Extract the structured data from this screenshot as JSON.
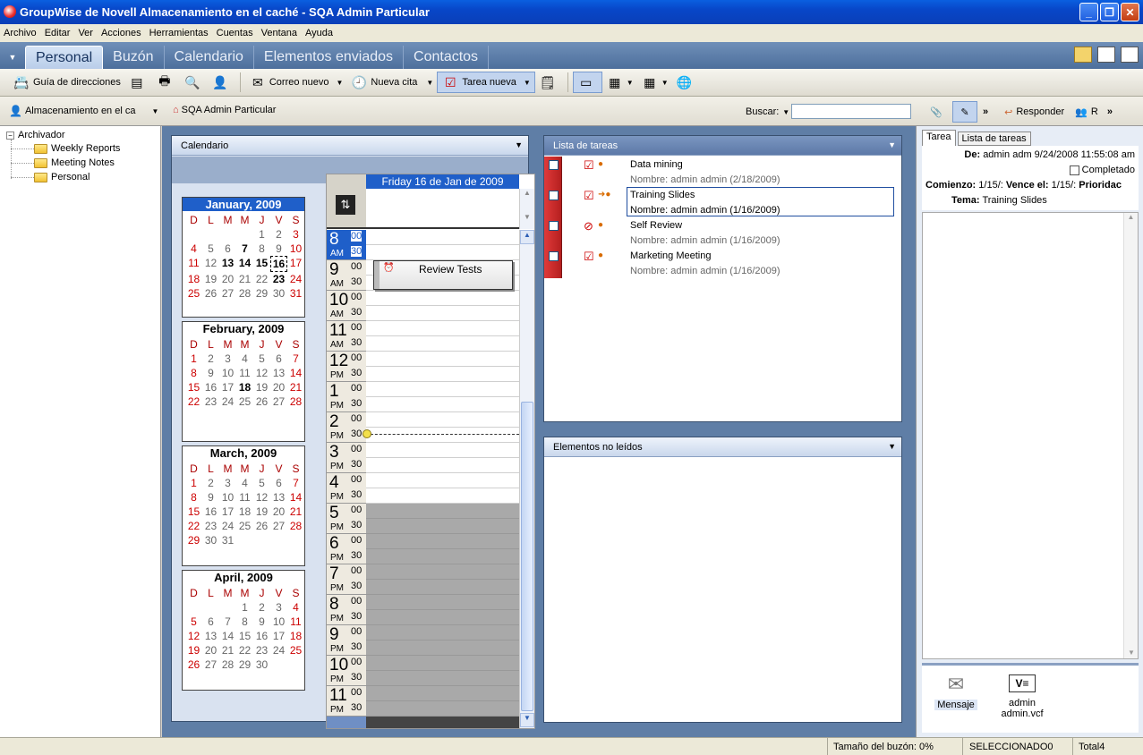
{
  "window": {
    "title": "GroupWise de Novell Almacenamiento en el caché - SQA Admin Particular",
    "min": "_",
    "max": "❐",
    "close": "✕"
  },
  "menu": [
    "Archivo",
    "Editar",
    "Ver",
    "Acciones",
    "Herramientas",
    "Cuentas",
    "Ventana",
    "Ayuda"
  ],
  "nav_tabs": [
    "Personal",
    "Buzón",
    "Calendario",
    "Elementos enviados",
    "Contactos"
  ],
  "toolbar": {
    "address_book": "Guía de direcciones",
    "new_mail": "Correo nuevo",
    "new_appt": "Nueva cita",
    "new_task": "Tarea nueva"
  },
  "location": {
    "mode": "Almacenamiento en el ca",
    "path": "SQA Admin Particular",
    "search_label": "Buscar:",
    "search_value": ""
  },
  "preview_toolbar": {
    "reply": "Responder",
    "more": "R"
  },
  "folders": {
    "root": "Archivador",
    "items": [
      "Weekly Reports",
      "Meeting Notes",
      "Personal"
    ]
  },
  "calendar_panel": {
    "title": "Calendario",
    "day_header": "Friday 16 de Jan de 2009",
    "appointment": "Review Tests"
  },
  "weekday_headers": [
    "D",
    "L",
    "M",
    "M",
    "J",
    "V",
    "S"
  ],
  "months": [
    {
      "title": "January, 2009",
      "start": 4,
      "days": 31,
      "bold": [
        7,
        13,
        14,
        15,
        16,
        23
      ],
      "today": 16
    },
    {
      "title": "February, 2009",
      "start": 0,
      "days": 28,
      "bold": [
        18
      ],
      "today": 0
    },
    {
      "title": "March, 2009",
      "start": 0,
      "days": 31,
      "bold": [],
      "today": 0
    },
    {
      "title": "April, 2009",
      "start": 3,
      "days": 30,
      "bold": [],
      "today": 0
    }
  ],
  "hours": [
    {
      "h": "8",
      "ap": "AM"
    },
    {
      "h": "9",
      "ap": "AM"
    },
    {
      "h": "10",
      "ap": "AM"
    },
    {
      "h": "11",
      "ap": "AM"
    },
    {
      "h": "12",
      "ap": "PM"
    },
    {
      "h": "1",
      "ap": "PM"
    },
    {
      "h": "2",
      "ap": "PM"
    },
    {
      "h": "3",
      "ap": "PM"
    },
    {
      "h": "4",
      "ap": "PM"
    },
    {
      "h": "5",
      "ap": "PM"
    },
    {
      "h": "6",
      "ap": "PM"
    },
    {
      "h": "7",
      "ap": "PM"
    },
    {
      "h": "8",
      "ap": "PM"
    },
    {
      "h": "9",
      "ap": "PM"
    },
    {
      "h": "10",
      "ap": "PM"
    },
    {
      "h": "11",
      "ap": "PM"
    }
  ],
  "minutes": [
    "00",
    "30"
  ],
  "tasks_panel": {
    "title": "Lista de tareas",
    "tasks": [
      {
        "title": "Data mining",
        "detail": "Nombre: admin admin (2/18/2009)"
      },
      {
        "title": "Training Slides",
        "detail": "Nombre: admin admin (1/16/2009)"
      },
      {
        "title": "Self Review",
        "detail": "Nombre: admin admin (1/16/2009)"
      },
      {
        "title": "Marketing Meeting",
        "detail": "Nombre: admin admin (1/16/2009)"
      }
    ]
  },
  "unread_panel": {
    "title": "Elementos no leídos"
  },
  "preview": {
    "tabs": [
      "Tarea",
      "Lista de tareas"
    ],
    "from_label": "De:",
    "from_value": "admin adm 9/24/2008 11:55:08 am",
    "completed": "Completado",
    "start_label": "Comienzo:",
    "start_value": "1/15/:",
    "due_label": "Vence el:",
    "due_value": "1/15/:",
    "priority_label": "Prioridac",
    "subject_label": "Tema:",
    "subject_value": "Training Slides",
    "attachments": [
      {
        "name": "Mensaje"
      },
      {
        "name": "admin admin.vcf"
      }
    ]
  },
  "status": {
    "mailbox": "Tamaño del buzón: 0%",
    "selected": "SELECCIONADO0",
    "total": "Total4"
  }
}
